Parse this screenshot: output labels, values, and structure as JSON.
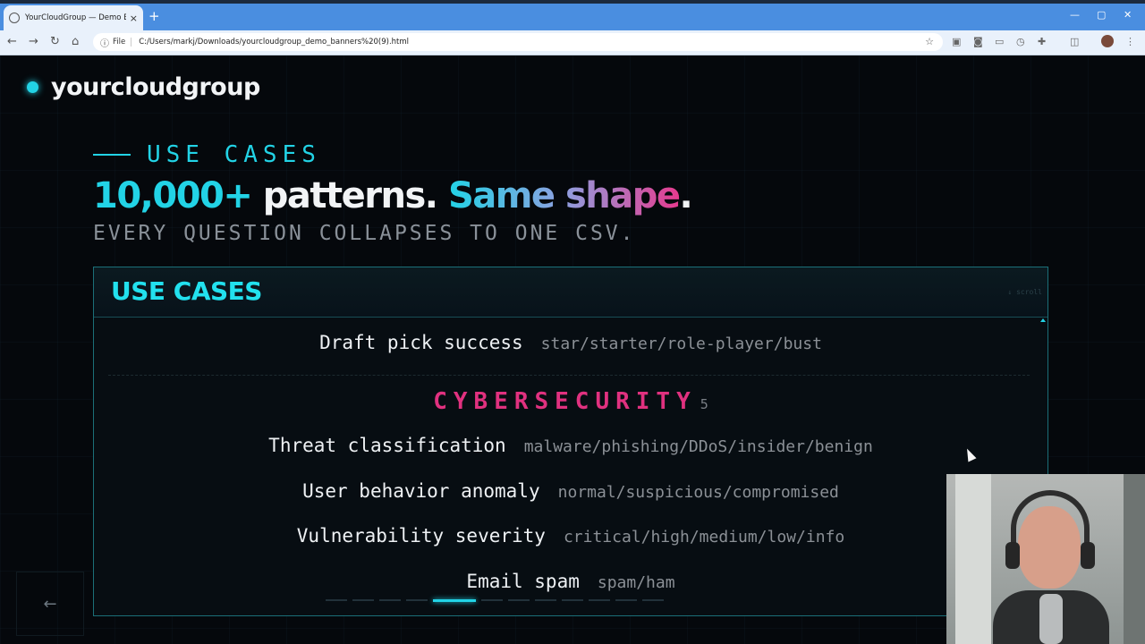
{
  "browser": {
    "tab_title": "YourCloudGroup — Demo Banners",
    "tab_close": "×",
    "new_tab": "+",
    "address_chip": "File",
    "url": "C:/Users/markj/Downloads/yourcloudgroup_demo_banners%20(9).html",
    "window_controls": {
      "minimize": "—",
      "maximize": "▢",
      "close": "✕"
    },
    "nav": {
      "back": "←",
      "forward": "→",
      "reload": "↻",
      "home": "⌂"
    }
  },
  "brand": {
    "name": "yourcloudgroup"
  },
  "hero": {
    "eyebrow": "USE CASES",
    "headline": {
      "part1": "10,000+",
      "part2": " patterns. ",
      "part3": "Same shape",
      "part4": "."
    },
    "subline": "EVERY QUESTION COLLAPSES TO ONE CSV."
  },
  "panel": {
    "title": "USE CASES",
    "scroll_hint": "↓ scroll",
    "top_row": {
      "label": "Draft pick success",
      "values": "star/starter/role-player/bust"
    },
    "section": {
      "name": "CYBERSECURITY",
      "count": "5"
    },
    "rows": [
      {
        "label": "Threat classification",
        "values": "malware/phishing/DDoS/insider/benign"
      },
      {
        "label": "User behavior anomaly",
        "values": "normal/suspicious/compromised"
      },
      {
        "label": "Vulnerability severity",
        "values": "critical/high/medium/low/info"
      },
      {
        "label": "Email spam",
        "values": "spam/ham"
      }
    ]
  },
  "pager": {
    "total": 12,
    "active_index": 4
  },
  "back_button": "←",
  "colors": {
    "accent": "#22d3e6",
    "section": "#e0317f",
    "background": "#05080c"
  }
}
